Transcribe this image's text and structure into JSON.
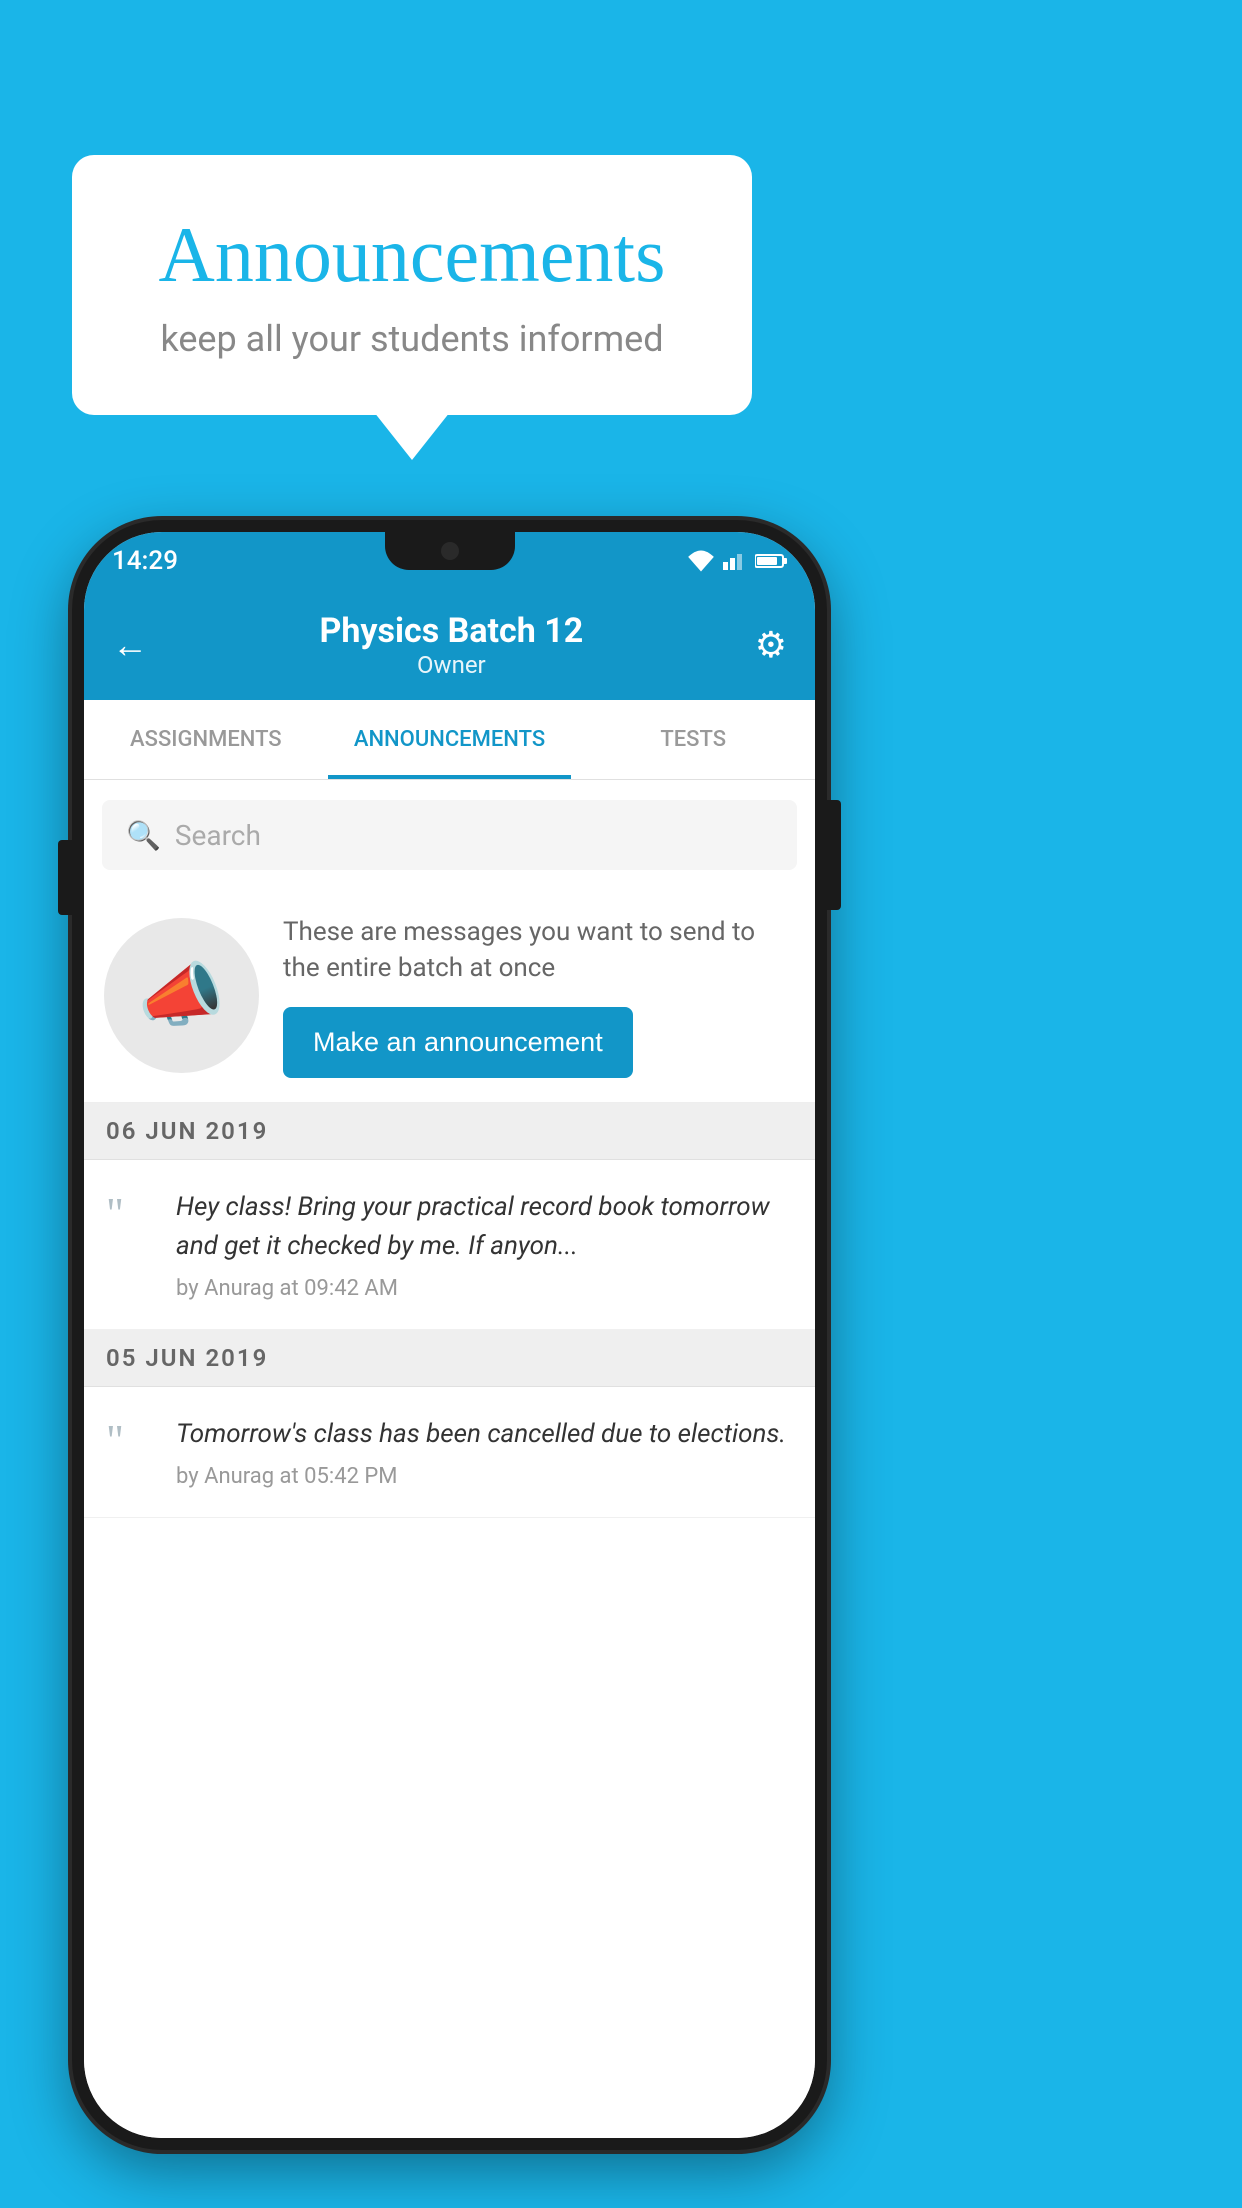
{
  "background": {
    "color": "#1ab5e8"
  },
  "speech_bubble": {
    "title": "Announcements",
    "subtitle": "keep all your students informed"
  },
  "phone": {
    "status_bar": {
      "time": "14:29"
    },
    "header": {
      "title": "Physics Batch 12",
      "subtitle": "Owner",
      "back_label": "←",
      "settings_label": "⚙"
    },
    "tabs": [
      {
        "label": "ASSIGNMENTS",
        "active": false
      },
      {
        "label": "ANNOUNCEMENTS",
        "active": true
      },
      {
        "label": "TESTS",
        "active": false
      }
    ],
    "search": {
      "placeholder": "Search"
    },
    "announcement_promo": {
      "description": "These are messages you want to send to the entire batch at once",
      "button_label": "Make an announcement"
    },
    "announcements": [
      {
        "date": "06  JUN  2019",
        "text": "Hey class! Bring your practical record book tomorrow and get it checked by me. If anyon...",
        "author": "by Anurag at 09:42 AM"
      },
      {
        "date": "05  JUN  2019",
        "text": "Tomorrow's class has been cancelled due to elections.",
        "author": "by Anurag at 05:42 PM"
      }
    ]
  }
}
